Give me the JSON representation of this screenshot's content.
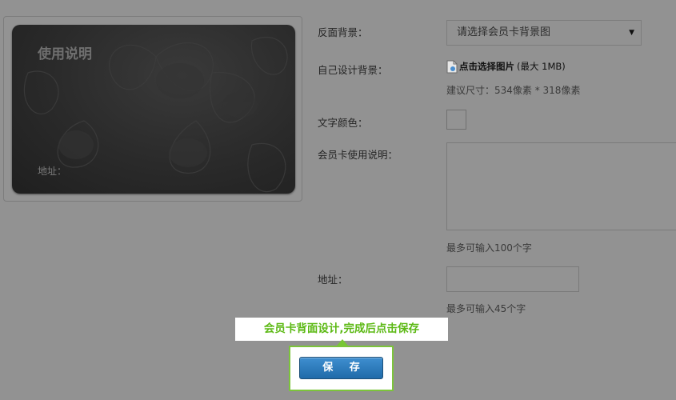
{
  "card_preview": {
    "title": "使用说明",
    "address_label": "地址："
  },
  "form": {
    "back_background_label": "反面背景：",
    "back_background_select": "请选择会员卡背景图",
    "custom_background_label": "自己设计背景：",
    "upload_link": "点击选择图片",
    "upload_limit": "(最大 1MB)",
    "size_hint": "建议尺寸：534像素 * 318像素",
    "text_color_label": "文字颜色：",
    "usage_label": "会员卡使用说明：",
    "usage_hint": "最多可输入100个字",
    "address_label": "地址：",
    "address_hint": "最多可输入45个字"
  },
  "guide": {
    "tooltip": "会员卡背面设计,完成后点击保存",
    "save_button": "保 存"
  },
  "colors": {
    "page_bg": "#929292",
    "card_bg": "#2a2a2a",
    "guide_green": "#5cb914",
    "button_blue": "#1f6aa9"
  }
}
